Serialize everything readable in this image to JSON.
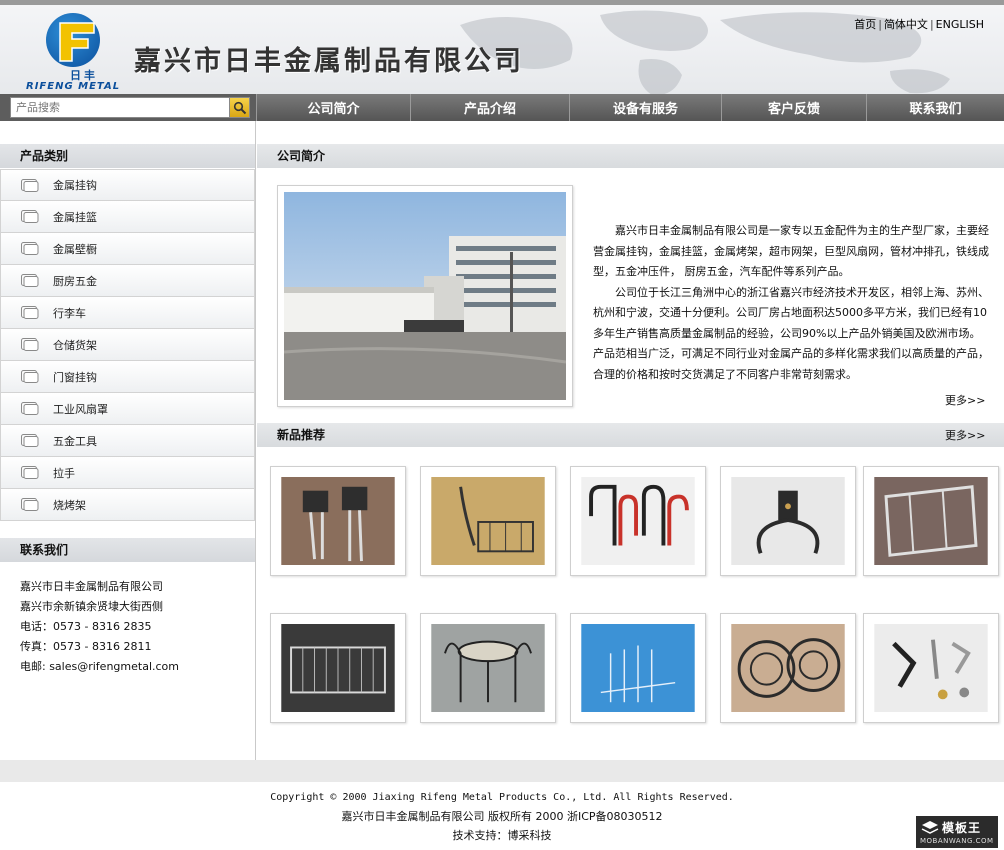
{
  "header": {
    "company_name": "嘉兴市日丰金属制品有限公司",
    "logo_cn": "日丰",
    "logo_en": "RIFENG METAL",
    "top_links": [
      "首页",
      "简体中文",
      "ENGLISH"
    ],
    "top_sep": "|"
  },
  "search": {
    "placeholder": "产品搜索"
  },
  "nav": {
    "items": [
      {
        "label": "公司简介"
      },
      {
        "label": "产品介绍"
      },
      {
        "label": "设备有服务"
      },
      {
        "label": "客户反馈"
      },
      {
        "label": "联系我们"
      }
    ]
  },
  "sidebar": {
    "categories_title": "产品类别",
    "categories": [
      "金属挂钩",
      "金属挂篮",
      "金属壁橱",
      "厨房五金",
      "行李车",
      "仓储货架",
      "门窗挂钩",
      "工业风扇罩",
      "五金工具",
      "拉手",
      "烧烤架"
    ],
    "contact_title": "联系我们",
    "contact_lines": [
      "嘉兴市日丰金属制品有限公司",
      "嘉兴市余新镇余贤埭大街西侧",
      "电话：0573 - 8316 2835",
      "传真：0573 - 8316 2811",
      "电邮: sales@rifengmetal.com"
    ]
  },
  "main": {
    "intro_title": "公司简介",
    "intro_paragraphs": [
      "嘉兴市日丰金属制品有限公司是一家专以五金配件为主的生产型厂家，主要经营金属挂钩，金属挂篮，金属烤架，超市网架，巨型风扇网，管材冲排孔，铁线成型，五金冲压件， 厨房五金，汽车配件等系列产品。",
      "公司位于长江三角洲中心的浙江省嘉兴市经济技术开发区，相邻上海、苏州、杭州和宁波，交通十分便利。公司厂房占地面积达5000多平方米，我们已经有10多年生产销售高质量金属制品的经验，公司90%以上产品外销美国及欧洲市场。产品范相当广泛，可满足不同行业对金属产品的多样化需求我们以高质量的产品，合理的价格和按时交货满足了不同客户非常苛刻需求。"
    ],
    "more_label": "更多>>",
    "new_title": "新品推荐"
  },
  "footer": {
    "copyright": "Copyright © 2000 Jiaxing Rifeng Metal Products Co., Ltd.  All Rights Reserved.",
    "rights_line": "嘉兴市日丰金属制品有限公司 版权所有 2000  浙ICP备08030512",
    "support_line": "技术支持：博采科技"
  },
  "watermark": {
    "top": "模板王",
    "bottom": "MOBANWANG.COM"
  },
  "colors": {
    "nav_bg": "#5d5d5d",
    "section_bar": "#dcdfe2",
    "logo_blue": "#0b4f9c",
    "logo_yellow": "#f2c200"
  },
  "icons": {
    "search": "magnifier-icon",
    "category": "folder-tab-icon"
  }
}
